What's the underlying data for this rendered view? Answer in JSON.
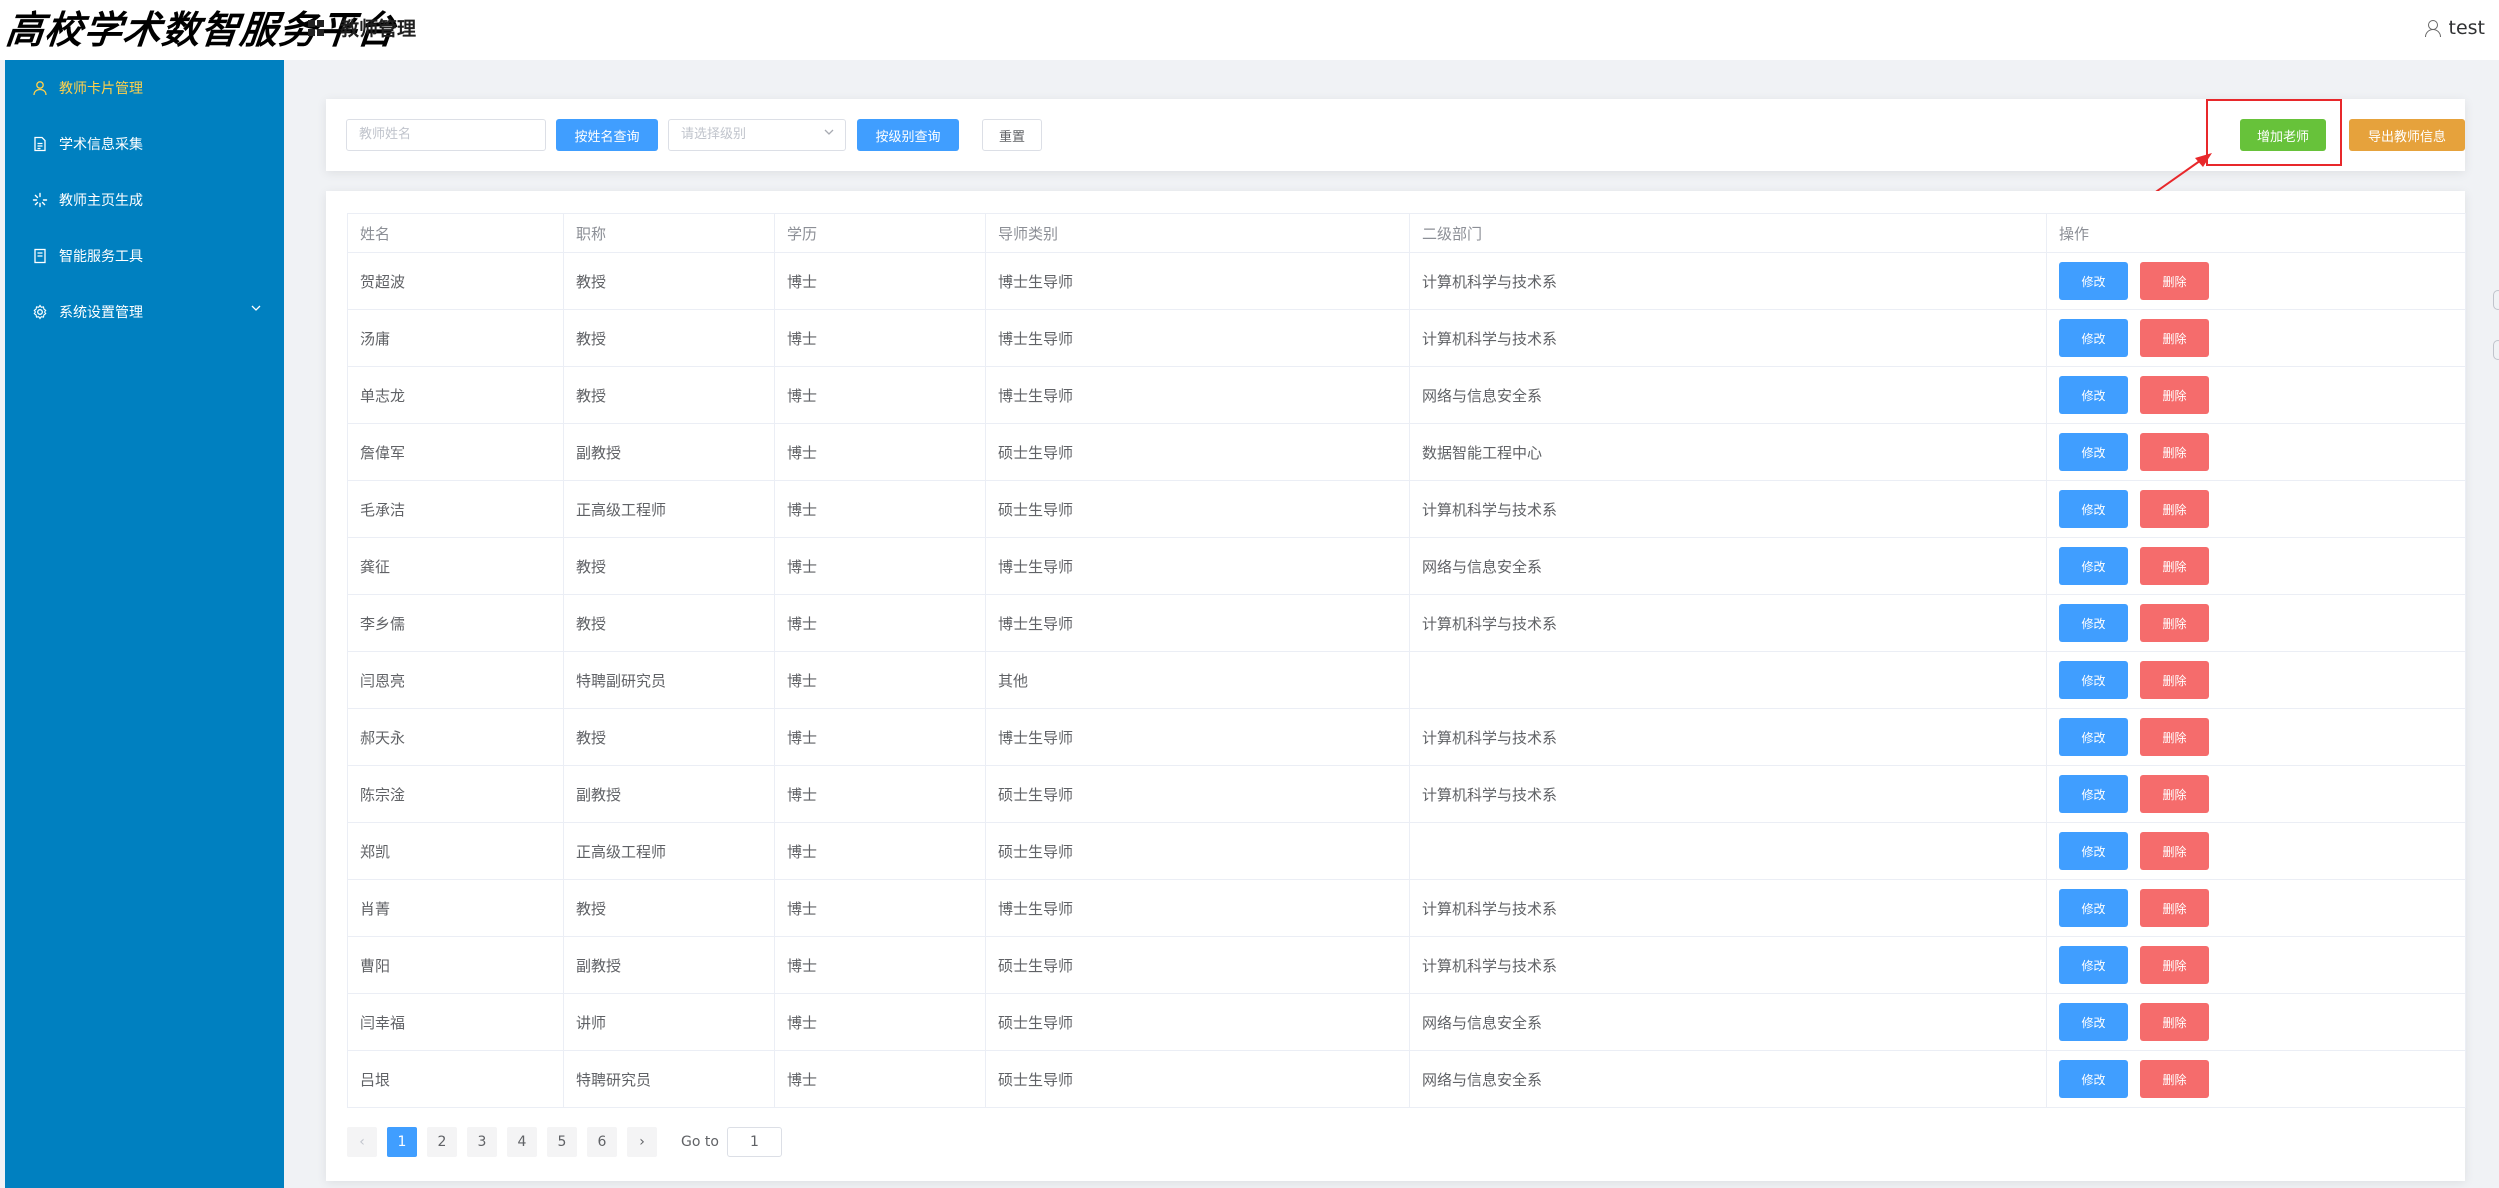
{
  "header": {
    "logo_text": "高校学术数智服务平台",
    "page_title": "教师管理",
    "user_name": "test"
  },
  "sidebar": {
    "items": [
      {
        "label": "教师卡片管理",
        "icon": "user-icon",
        "active": true
      },
      {
        "label": "学术信息采集",
        "icon": "document-icon",
        "active": false
      },
      {
        "label": "教师主页生成",
        "icon": "loading-icon",
        "active": false
      },
      {
        "label": "智能服务工具",
        "icon": "notebook-icon",
        "active": false
      },
      {
        "label": "系统设置管理",
        "icon": "gear-icon",
        "active": false,
        "has_submenu": true
      }
    ],
    "bg_color": "#0080c0",
    "active_color": "#ffd04b"
  },
  "search": {
    "name_placeholder": "教师姓名",
    "search_by_name": "按姓名查询",
    "level_placeholder": "请选择级别",
    "search_by_level": "按级别查询",
    "reset": "重置",
    "add_teacher": "增加老师",
    "export": "导出教师信息"
  },
  "table": {
    "columns": [
      "姓名",
      "职称",
      "学历",
      "导师类别",
      "二级部门",
      "操作"
    ],
    "edit_label": "修改",
    "delete_label": "删除",
    "rows": [
      [
        "贺超波",
        "教授",
        "博士",
        "博士生导师",
        "计算机科学与技术系"
      ],
      [
        "汤庸",
        "教授",
        "博士",
        "博士生导师",
        "计算机科学与技术系"
      ],
      [
        "单志龙",
        "教授",
        "博士",
        "博士生导师",
        "网络与信息安全系"
      ],
      [
        "詹偉军",
        "副教授",
        "博士",
        "硕士生导师",
        "数据智能工程中心"
      ],
      [
        "毛承洁",
        "正高级工程师",
        "博士",
        "硕士生导师",
        "计算机科学与技术系"
      ],
      [
        "龚征",
        "教授",
        "博士",
        "博士生导师",
        "网络与信息安全系"
      ],
      [
        "李乡儒",
        "教授",
        "博士",
        "博士生导师",
        "计算机科学与技术系"
      ],
      [
        "闫恩亮",
        "特聘副研究员",
        "博士",
        "其他",
        ""
      ],
      [
        "郝天永",
        "教授",
        "博士",
        "博士生导师",
        "计算机科学与技术系"
      ],
      [
        "陈宗淦",
        "副教授",
        "博士",
        "硕士生导师",
        "计算机科学与技术系"
      ],
      [
        "郑凯",
        "正高级工程师",
        "博士",
        "硕士生导师",
        ""
      ],
      [
        "肖菁",
        "教授",
        "博士",
        "博士生导师",
        "计算机科学与技术系"
      ],
      [
        "曹阳",
        "副教授",
        "博士",
        "硕士生导师",
        "计算机科学与技术系"
      ],
      [
        "闫幸福",
        "讲师",
        "博士",
        "硕士生导师",
        "网络与信息安全系"
      ],
      [
        "吕垠",
        "特聘研究员",
        "博士",
        "硕士生导师",
        "网络与信息安全系"
      ]
    ]
  },
  "pagination": {
    "prev": "‹",
    "next": "›",
    "pages": [
      "1",
      "2",
      "3",
      "4",
      "5",
      "6"
    ],
    "current": "1",
    "goto_label": "Go to",
    "goto_value": "1"
  },
  "colors": {
    "primary": "#409eff",
    "danger": "#f56c6c",
    "success": "#67c23a",
    "warning": "#e6a23c",
    "annotation_red": "#e8282b"
  }
}
